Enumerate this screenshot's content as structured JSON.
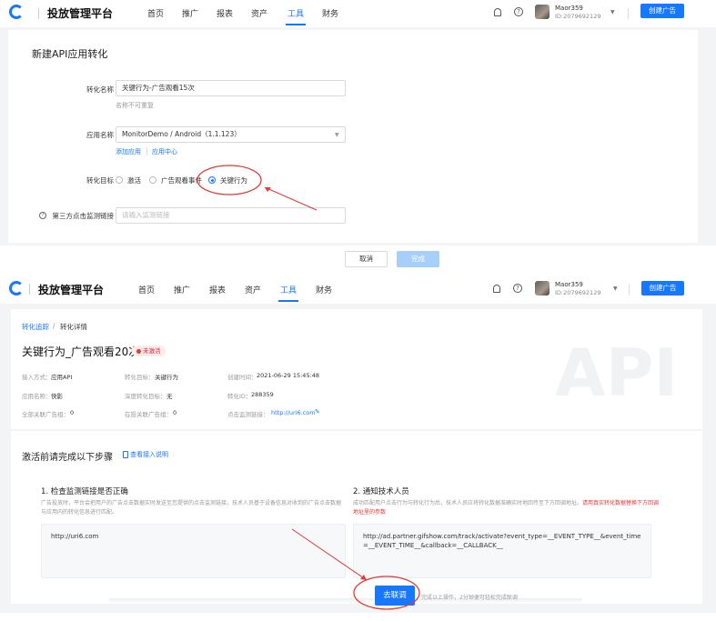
{
  "app": {
    "title": "投放管理平台",
    "nav": [
      "首页",
      "推广",
      "报表",
      "资产",
      "工具",
      "财务"
    ],
    "active_nav": "工具",
    "user_name": "Maor359",
    "user_id": "ID:2079692129",
    "create_button": "创建广告"
  },
  "form": {
    "title": "新建API应用转化",
    "name_label": "转化名称",
    "name_value": "关键行为-广告观看15次",
    "name_hint": "名称不可重复",
    "app_label": "应用名称",
    "app_value": "MonitorDemo / Android（1.1.123）",
    "add_app_link": "添加应用",
    "app_center_link": "应用中心",
    "target_label": "转化目标",
    "targets": [
      "激活",
      "广告观看事件",
      "关键行为"
    ],
    "selected_target": "关键行为",
    "monitor_label": "第三方点击监测链接",
    "monitor_placeholder": "请输入监测链接",
    "cancel": "取消",
    "done": "完成"
  },
  "detail": {
    "breadcrumb_root": "转化追踪",
    "breadcrumb_sep": "/",
    "breadcrumb_current": "转化详情",
    "title": "关键行为_广告观看20次",
    "status": "未激活",
    "fields": {
      "row1": [
        {
          "k": "接入方式：",
          "v": "应用API"
        },
        {
          "k": "转化目标：",
          "v": "关键行为"
        },
        {
          "k": "创建时间：",
          "v": "2021-06-29 15:45:48"
        }
      ],
      "row2": [
        {
          "k": "应用名称：",
          "v": "快影"
        },
        {
          "k": "深度转化目标：",
          "v": "无"
        },
        {
          "k": "转化ID：",
          "v": "288359"
        }
      ],
      "row3": [
        {
          "k": "全部关联广告组：",
          "v": "0"
        },
        {
          "k": "在投关联广告组：",
          "v": "0"
        },
        {
          "k": "点击监测链接：",
          "v": "http://uri6.com"
        }
      ]
    },
    "watermark": "API",
    "steps_title": "激活前请完成以下步骤",
    "doc_link": "查看接入说明",
    "step1_title": "1. 检查监测链接是否正确",
    "step1_desc": "广告投放时，平台会把用户的广告点击数据实时发送至您提供的点击监测链接，技术人员基于设备信息对收到的广告点击数据与应用内的转化信息进行匹配。",
    "step1_code": "http://uri6.com",
    "step2_title": "2. 通知技术人员",
    "step2_desc": "成功匹配用户点击行为与转化行为后，技术人员应将转化数据准确实时地回传至下方回调地址。",
    "step2_desc_red": "请用真实转化数据替换下方回调地址里的参数",
    "step2_code": "http://ad.partner.gifshow.com/track/activate?event_type=__EVENT_TYPE__&event_time=__EVENT_TIME__&callback=__CALLBACK__",
    "go_button": "去联调",
    "tail_text": "完成以上操作，2分钟便可轻松完成联调"
  }
}
